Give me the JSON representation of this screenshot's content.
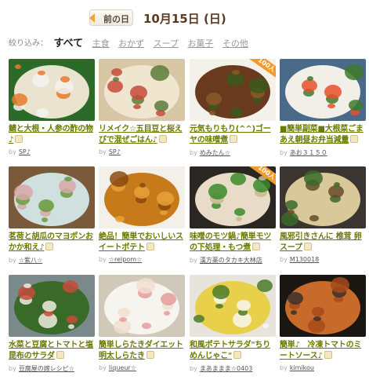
{
  "header": {
    "prev_label": "前の日",
    "date": "10月15日 (日)"
  },
  "filter": {
    "label": "絞り込み：",
    "items": [
      "すべて",
      "主食",
      "おかず",
      "スープ",
      "お菓子",
      "その他"
    ],
    "active": "すべて"
  },
  "recipes": [
    {
      "title": "鯖と大根・人参の酢の物♪",
      "author": "SP♪",
      "badge": "",
      "palette": [
        "#2c6a2a",
        "#e9e3cf",
        "#e87a2a",
        "#f2f2ee"
      ]
    },
    {
      "title": "リメイク☆五目豆と桜えびで混ぜごはん♪",
      "author": "SP♪",
      "badge": "",
      "palette": [
        "#d8c7a4",
        "#f0e6d0",
        "#c84a3a",
        "#5a7a3a"
      ]
    },
    {
      "title": "元気もりもり(^^)ゴーヤの味噌煮",
      "author": "めみたん☆",
      "badge": "100人",
      "palette": [
        "#f4f1ea",
        "#6a3a1e",
        "#3a5a1a",
        "#8a5a2a"
      ]
    },
    {
      "title": "■簡単副菜■大根菜ごまあえ朝昼お弁当減量",
      "author": "あお３１５０",
      "badge": "",
      "palette": [
        "#4a6a8a",
        "#f1efe8",
        "#3f7a2a",
        "#e8502a"
      ]
    },
    {
      "title": "茗荷と胡瓜のマヨポンおかか和え♪",
      "author": "☆紫八☆",
      "badge": "",
      "palette": [
        "#7a5a3a",
        "#cfe0df",
        "#6a9a3a",
        "#d8a8a8"
      ]
    },
    {
      "title": "絶品！簡単でおいしいスイートポテト",
      "author": "☆relpom☆",
      "badge": "",
      "palette": [
        "#f3f0ea",
        "#c77a1a",
        "#e8a23a",
        "#8a4a10"
      ]
    },
    {
      "title": "味噌のモツ鍋♪簡単モツの下処理・もつ煮",
      "author": "漢方薬のタカキ大林店",
      "badge": "100人",
      "palette": [
        "#2a2622",
        "#e8dcc8",
        "#3a8a2a",
        "#c8b890"
      ]
    },
    {
      "title": "風邪引きさんに 椎茸 卵スープ",
      "author": "M130018",
      "badge": "",
      "palette": [
        "#3a3530",
        "#d8c89a",
        "#3a6a2a",
        "#6a4a2a"
      ]
    },
    {
      "title": "水菜と豆腐とトマトと塩昆布のサラダ",
      "author": "豆腐屋の嫁レシピ☆",
      "badge": "",
      "palette": [
        "#7a8a8a",
        "#3a6a2a",
        "#f0ece2",
        "#c84a3a"
      ]
    },
    {
      "title": "簡単しらたきダイエット明太しらたき",
      "author": "liqueur☆",
      "badge": "",
      "palette": [
        "#d0c8b8",
        "#f6f4ee",
        "#e89a9a",
        "#f0e0d0"
      ]
    },
    {
      "title": "和風ポテトサラダ\"ちりめんじゃこ\"",
      "author": "まあままま☆0403",
      "badge": "",
      "palette": [
        "#e8e4dc",
        "#e8d04a",
        "#4a7a2a",
        "#f8f6f0"
      ]
    },
    {
      "title": "簡単♪　冷凍トマトのミートソース♪",
      "author": "kimikou",
      "badge": "",
      "palette": [
        "#1a1612",
        "#c86a2a",
        "#a84a1a",
        "#3a302a"
      ]
    }
  ]
}
